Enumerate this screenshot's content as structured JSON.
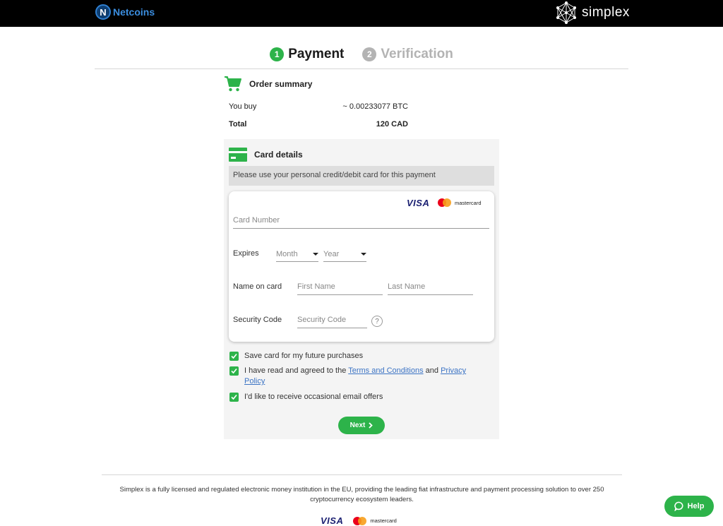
{
  "header": {
    "left_logo_letter": "N",
    "left_logo_text": "Netcoins",
    "right_logo_text": "simplex"
  },
  "steps": [
    {
      "number": "1",
      "label": "Payment"
    },
    {
      "number": "2",
      "label": "Verification"
    }
  ],
  "order": {
    "title": "Order summary",
    "you_buy_label": "You buy",
    "you_buy_value": "~ 0.00233077 BTC",
    "total_label": "Total",
    "total_value": "120 CAD"
  },
  "card": {
    "title": "Card details",
    "notice": "Please use your personal credit/debit card for this payment",
    "visa": "VISA",
    "mastercard": "mastercard",
    "card_number_placeholder": "Card Number",
    "expires_label": "Expires",
    "month_placeholder": "Month",
    "year_placeholder": "Year",
    "name_label": "Name on card",
    "first_name_placeholder": "First Name",
    "last_name_placeholder": "Last Name",
    "security_label": "Security Code",
    "security_placeholder": "Security Code",
    "help_glyph": "?"
  },
  "checks": {
    "save_card": "Save card for my future purchases",
    "terms_prefix": "I have read and agreed to the ",
    "terms_link": "Terms and Conditions",
    "terms_mid": " and ",
    "privacy_link_1": "Privacy",
    "privacy_link_2": "Policy",
    "email_offers": "I'd like to receive occasional email offers"
  },
  "next_label": "Next",
  "footer": {
    "text": "Simplex is a fully licensed and regulated electronic money institution in the EU, providing the leading fiat infrastructure and payment processing solution to over 250 cryptocurrency ecosystem leaders.",
    "visa": "VISA",
    "mastercard": "mastercard"
  },
  "help_label": "Help",
  "colors": {
    "accent_green": "#2db34a",
    "link_blue": "#3b73c4",
    "topbar": "#000000"
  }
}
